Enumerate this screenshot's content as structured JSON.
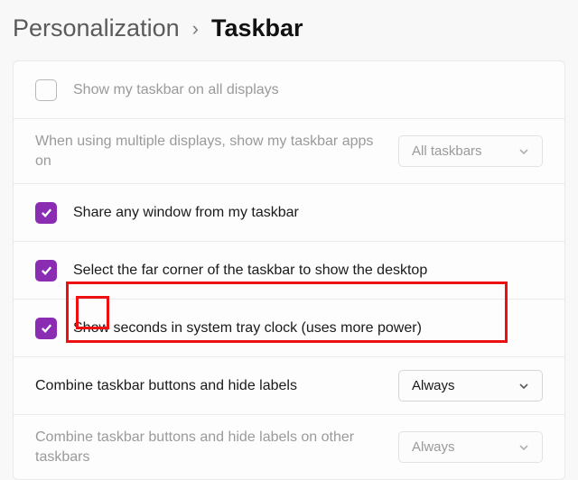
{
  "breadcrumb": {
    "parent": "Personalization",
    "separator": "›",
    "current": "Taskbar"
  },
  "rows": {
    "showAll": {
      "label": "Show my taskbar on all displays",
      "checked": false,
      "disabled": true
    },
    "multiDisplay": {
      "label": "When using multiple displays, show my taskbar apps on",
      "select": "All taskbars",
      "disabled": true
    },
    "shareWindow": {
      "label": "Share any window from my taskbar",
      "checked": true
    },
    "farCorner": {
      "label": "Select the far corner of the taskbar to show the desktop",
      "checked": true
    },
    "showSeconds": {
      "label": "Show seconds in system tray clock (uses more power)",
      "checked": true
    },
    "combine": {
      "label": "Combine taskbar buttons and hide labels",
      "select": "Always"
    },
    "combineOther": {
      "label": "Combine taskbar buttons and hide labels on other taskbars",
      "select": "Always",
      "disabled": true
    }
  }
}
